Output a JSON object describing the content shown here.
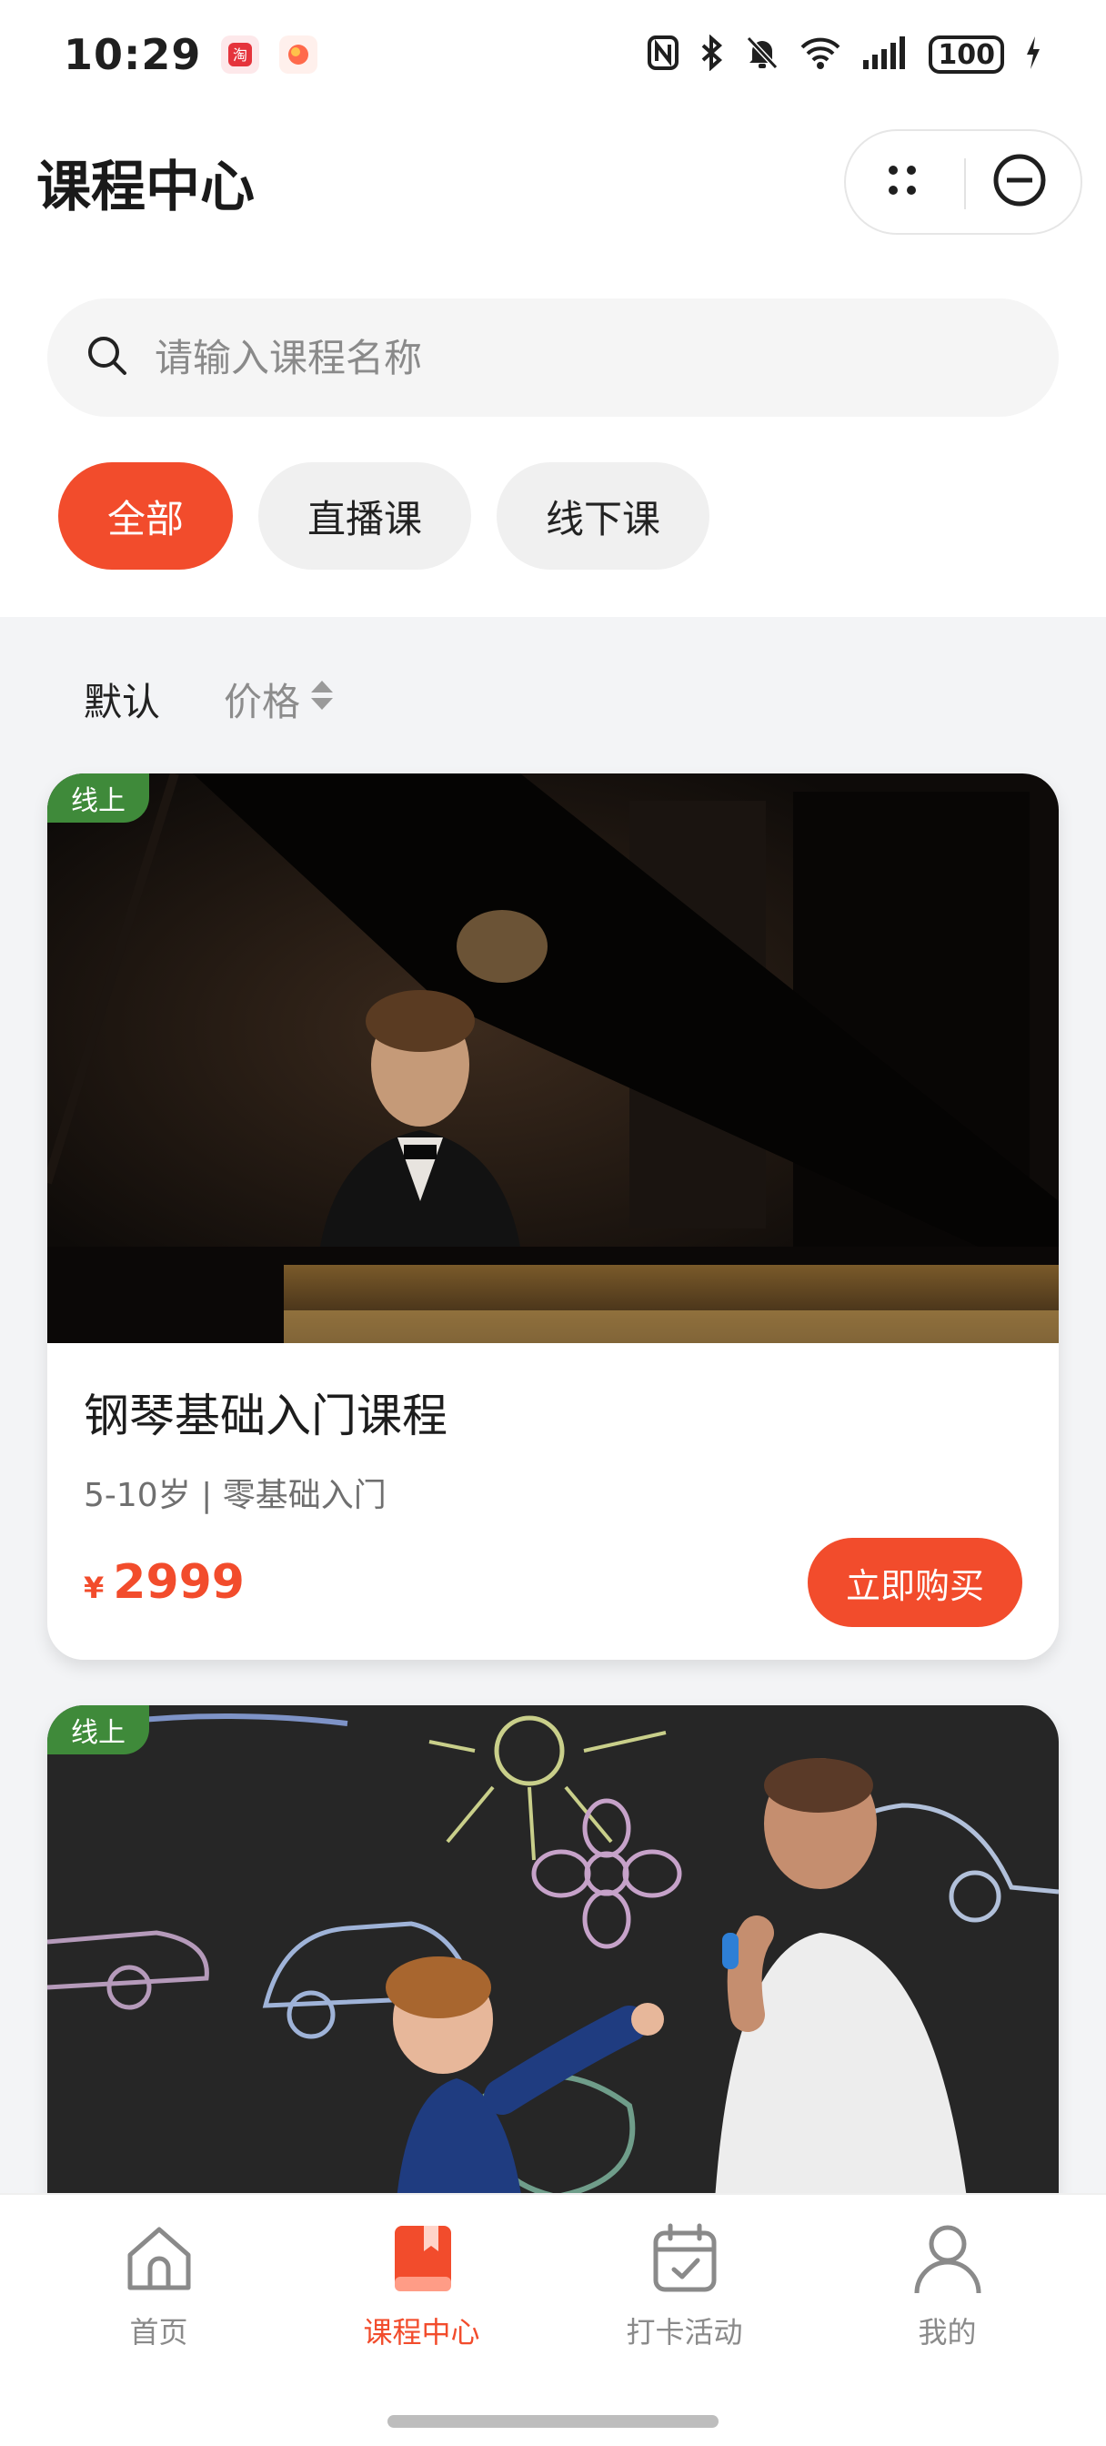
{
  "status_bar": {
    "time": "10:29",
    "battery": "100"
  },
  "header": {
    "title": "课程中心"
  },
  "search": {
    "placeholder": "请输入课程名称"
  },
  "tabs": [
    {
      "label": "全部",
      "active": true
    },
    {
      "label": "直播课",
      "active": false
    },
    {
      "label": "线下课",
      "active": false
    }
  ],
  "sort": {
    "default_label": "默认",
    "price_label": "价格"
  },
  "courses": [
    {
      "tag": "线上",
      "title": "钢琴基础入门课程",
      "subtitle": "5-10岁 | 零基础入门",
      "currency": "¥",
      "price": "2999",
      "buy_label": "立即购买",
      "image": "piano-player-photo"
    },
    {
      "tag": "线上",
      "image": "chalkboard-drawing-photo"
    }
  ],
  "bottom_nav": {
    "items": [
      {
        "label": "首页",
        "icon": "home-icon"
      },
      {
        "label": "课程中心",
        "icon": "book-icon",
        "active": true
      },
      {
        "label": "打卡活动",
        "icon": "calendar-check-icon"
      },
      {
        "label": "我的",
        "icon": "user-icon"
      }
    ]
  },
  "colors": {
    "accent": "#f24c2c",
    "tag_green": "#3f8a3a",
    "background_gray": "#f3f4f6"
  }
}
